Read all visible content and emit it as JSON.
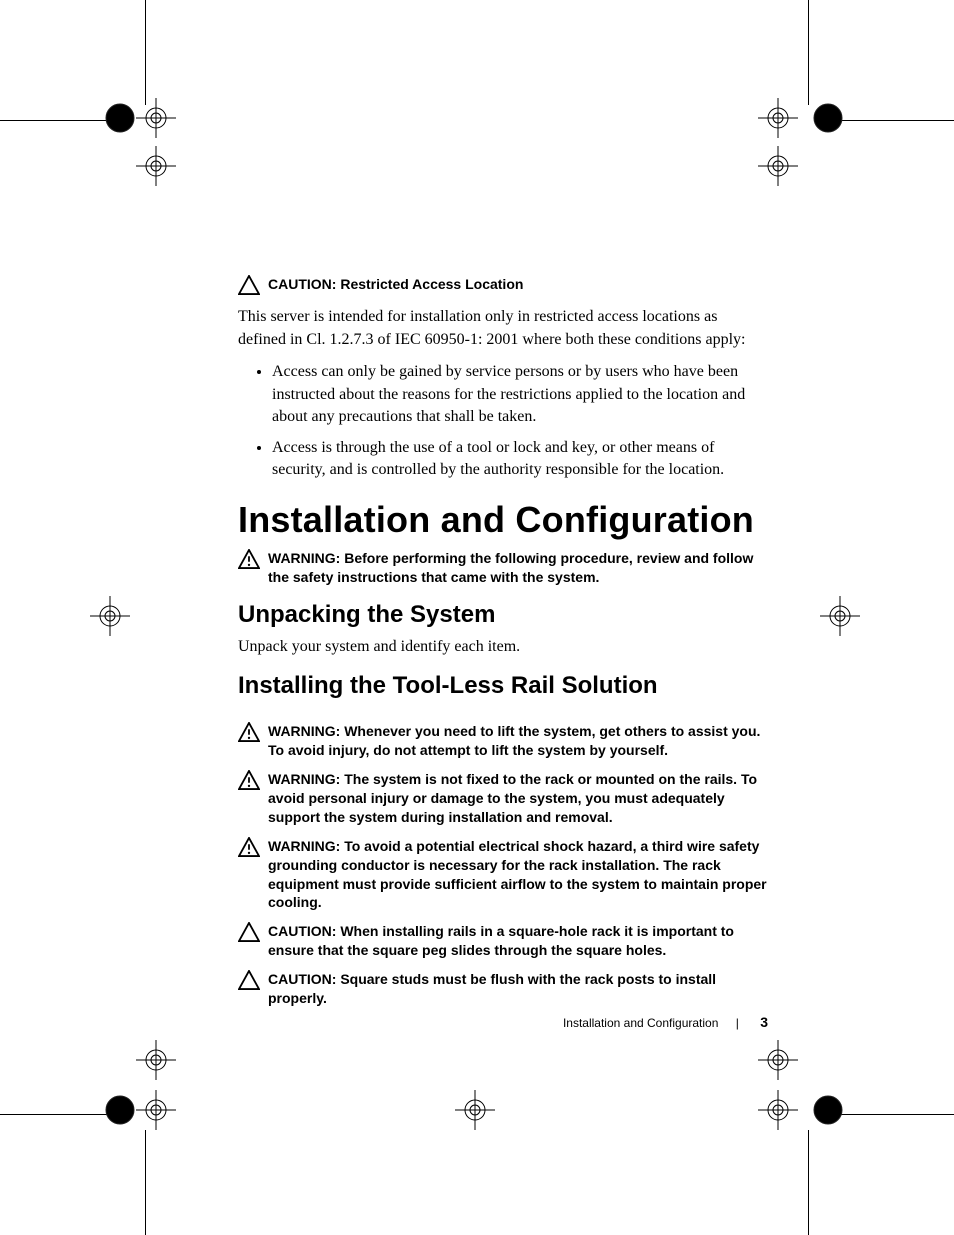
{
  "caution1": {
    "label": "CAUTION:",
    "text": "Restricted Access Location"
  },
  "intro": "This server is intended for installation only in restricted access locations as defined in Cl. 1.2.7.3 of IEC 60950-1: 2001 where both these conditions apply:",
  "bullets": [
    "Access can only be gained by service persons or by users who have been instructed about the reasons for the restrictions applied to the location and about any precautions that shall be taken.",
    "Access is through the use of a tool or lock and key, or other means of security, and is controlled by the authority responsible for the location."
  ],
  "h1": "Installation and Configuration",
  "warn1": {
    "label": "WARNING: ",
    "text": "Before performing the following procedure, review and follow the safety instructions that came with the system."
  },
  "h2a": "Unpacking the System",
  "unpack_text": "Unpack your system and identify each item.",
  "h2b": "Installing the Tool-Less Rail Solution",
  "warn2": {
    "label": "WARNING: ",
    "text": "Whenever you need to lift the system, get others to assist you. To avoid injury, do not attempt to lift the system by yourself."
  },
  "warn3": {
    "label": "WARNING: ",
    "text": "The system is not fixed to the rack or mounted on the rails. To avoid personal injury or damage to the system, you must adequately support the system during installation and removal."
  },
  "warn4": {
    "label": "WARNING: ",
    "text": "To avoid a potential electrical shock hazard, a third wire safety grounding conductor is necessary for the rack installation. The rack equipment must provide sufficient airflow to the system to maintain proper cooling."
  },
  "caution2": {
    "label": "CAUTION:",
    "text": "When installing rails in a square-hole rack it is important to ensure that the square peg slides through the square holes."
  },
  "caution3": {
    "label": "CAUTION:",
    "text": "Square studs must be flush with the rack posts to install properly."
  },
  "footer": {
    "title": "Installation and Configuration",
    "page": "3"
  }
}
